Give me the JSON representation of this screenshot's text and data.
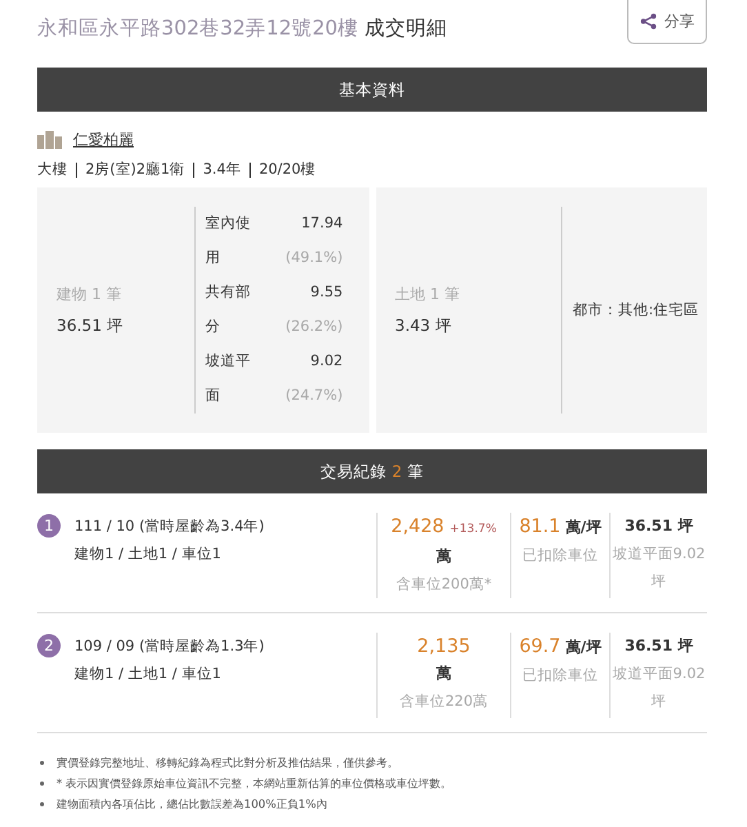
{
  "header": {
    "address": "永和區永平路302巷32弄12號20樓",
    "title": "成交明細",
    "share_label": "分享"
  },
  "basic": {
    "heading": "基本資料",
    "community": "仁愛柏麗",
    "specs": [
      "大樓",
      "2房(室)2廳1衛",
      "3.4年",
      "20/20樓"
    ],
    "building": {
      "label": "建物 1 筆",
      "area": "36.51 坪",
      "parts": [
        {
          "name": "室內使用",
          "value": "17.94",
          "share": "(49.1%)"
        },
        {
          "name": "共有部分",
          "value": "9.55",
          "share": "(26.2%)"
        },
        {
          "name": "坡道平面",
          "value": "9.02",
          "share": "(24.7%)"
        }
      ]
    },
    "land": {
      "label": "土地 1 筆",
      "area": "3.43 坪",
      "zoning": "都市：其他:住宅區"
    }
  },
  "records": {
    "heading": "交易紀錄",
    "count": "2",
    "unit": "筆",
    "items": [
      {
        "index": "1",
        "date": "111 / 10 (當時屋齡為3.4年)",
        "parts": "建物1 / 土地1 / 車位1",
        "price": "2,428",
        "change": "+13.7%",
        "price_unit": "萬",
        "parking": "含車位200萬*",
        "unit_price": "81.1",
        "unit_price_unit": "萬/坪",
        "unit_note": "已扣除車位",
        "area": "36.51 坪",
        "area_note": "坡道平面9.02坪"
      },
      {
        "index": "2",
        "date": "109 / 09 (當時屋齡為1.3年)",
        "parts": "建物1 / 土地1 / 車位1",
        "price": "2,135",
        "price_unit": "萬",
        "parking": "含車位220萬",
        "unit_price": "69.7",
        "unit_price_unit": "萬/坪",
        "unit_note": "已扣除車位",
        "area": "36.51 坪",
        "area_note": "坡道平面9.02坪"
      }
    ]
  },
  "notes": [
    "實價登錄完整地址、移轉紀錄為程式比對分析及推估結果，僅供參考。",
    "* 表示因實價登錄原始車位資訊不完整，本網站重新估算的車位價格或車位坪數。",
    "建物面積內各項佔比，總佔比數誤差為100%正負1%內"
  ]
}
